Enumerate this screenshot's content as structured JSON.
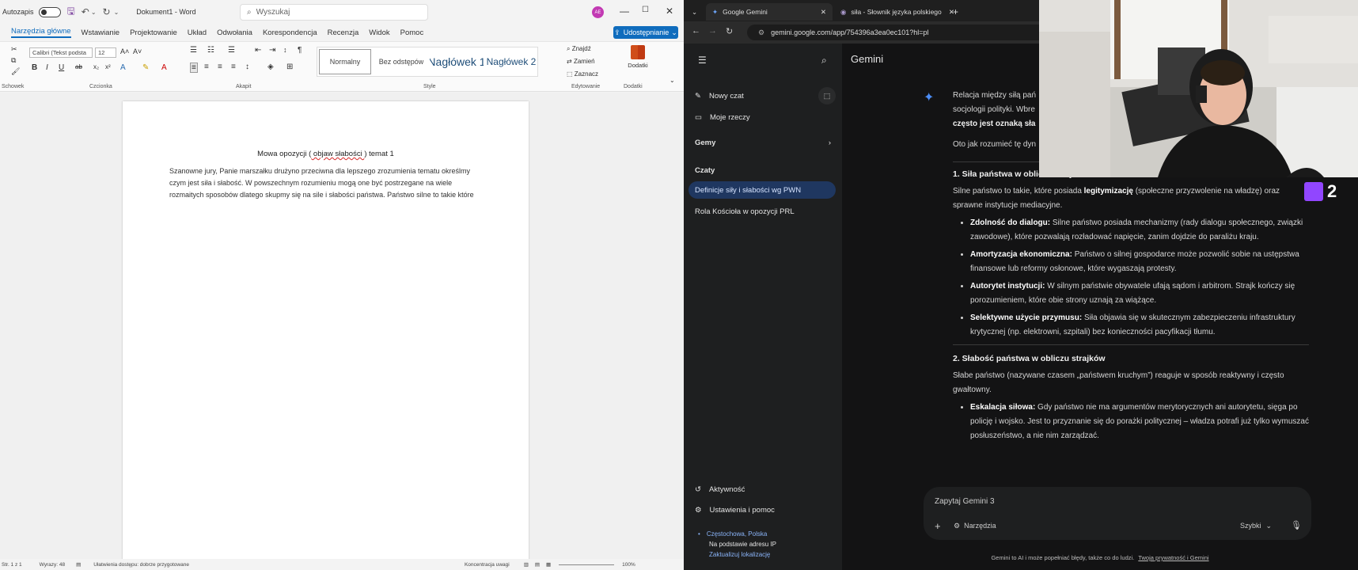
{
  "word": {
    "autosave_label": "Autozapis",
    "doc_title": "Dokument1 - Word",
    "search_placeholder": "Wyszukaj",
    "avatar": "AE",
    "menu": [
      "Narzędzia główne",
      "Wstawianie",
      "Projektowanie",
      "Układ",
      "Odwołania",
      "Korespondencja",
      "Recenzja",
      "Widok",
      "Pomoc"
    ],
    "share_label": "Udostępnianie",
    "font_name": "Calibri (Tekst podsta",
    "font_size": "12",
    "styles": [
      "Normalny",
      "Bez odstępów",
      "Nagłówek 1",
      "Nagłówek 2"
    ],
    "editing": {
      "find": "Znajdź",
      "replace": "Zamień",
      "select": "Zaznacz"
    },
    "addins_label": "Dodatki",
    "groups": {
      "clipboard": "Schowek",
      "font": "Czcionka",
      "paragraph": "Akapit",
      "styles": "Style",
      "editing": "Edytowanie",
      "addins": "Dodatki"
    },
    "document": {
      "title_prefix": "Mowa opozycji (",
      "title_underlined": " objaw słabości ",
      "title_suffix": ") temat 1",
      "body": "Szanowne jury, Panie marszałku drużyno przeciwna dla lepszego zrozumienia tematu określmy czym jest siła i słabość. W powszechnym rozumieniu mogą one być postrzegane na wiele rozmaitych sposobów dlatego skupmy się na sile i słabości państwa. Państwo silne to takie które"
    },
    "status": {
      "page": "Str. 1 z 1",
      "words": "Wyrazy: 48",
      "accessibility": "Ułatwienia dostępu: dobrze przygotowane",
      "focus": "Koncentracja uwagi",
      "zoom": "100%"
    }
  },
  "browser": {
    "tabs": [
      {
        "label": "Google Gemini"
      },
      {
        "label": "siła - Słownik języka polskiego"
      }
    ],
    "url": "gemini.google.com/app/754396a3ea0ec101?hl=pl"
  },
  "gemini": {
    "app_title": "Gemini",
    "new_chat": "Nowy czat",
    "my_stuff": "Moje rzeczy",
    "gems": "Gemy",
    "chats_header": "Czaty",
    "chats": [
      "Definicje siły i słabości wg PWN",
      "Rola Kościoła w opozycji PRL"
    ],
    "activity": "Aktywność",
    "settings": "Ustawienia i pomoc",
    "location": "Częstochowa, Polska",
    "location_source": "Na podstawie adresu IP",
    "update_location": "Zaktualizuj lokalizację",
    "intro_line1": "Relacja między siłą pań",
    "intro_line2": "socjologii polityki. Wbre",
    "intro_line3": "często jest oznaką sła",
    "intro_line4": "Oto jak rozumieć tę dyn",
    "section1_title": "1. Siła państwa w obliczu strajków",
    "section1_intro_a": "Silne państwo to takie, które posiada ",
    "section1_intro_b": "legitymizację",
    "section1_intro_c": " (społeczne przyzwolenie na władzę) oraz sprawne instytucje mediacyjne.",
    "section1_items": [
      {
        "head": "Zdolność do dialogu:",
        "text": " Silne państwo posiada mechanizmy (rady dialogu społecznego, związki zawodowe), które pozwalają rozładować napięcie, zanim dojdzie do paraliżu kraju."
      },
      {
        "head": "Amortyzacja ekonomiczna:",
        "text": " Państwo o silnej gospodarce może pozwolić sobie na ustępstwa finansowe lub reformy osłonowe, które wygaszają protesty."
      },
      {
        "head": "Autorytet instytucji:",
        "text": " W silnym państwie obywatele ufają sądom i arbitrom. Strajk kończy się porozumieniem, które obie strony uznają za wiążące."
      },
      {
        "head": "Selektywne użycie przymusu:",
        "text": " Siła objawia się w skutecznym zabezpieczeniu infrastruktury krytycznej (np. elektrowni, szpitali) bez konieczności pacyfikacji tłumu."
      }
    ],
    "section2_title": "2. Słabość państwa w obliczu strajków",
    "section2_intro": "Słabe państwo (nazywane czasem „państwem kruchym”) reaguje w sposób reaktywny i często gwałtowny.",
    "section2_items": [
      {
        "head": "Eskalacja siłowa:",
        "text": " Gdy państwo nie ma argumentów merytorycznych ani autorytetu, sięga po policję i wojsko. Jest to przyznanie się do porażki politycznej – władza potrafi już tylko wymuszać posłuszeństwo, a nie nim zarządzać."
      }
    ],
    "input_placeholder": "Zapytaj Gemini 3",
    "tools_label": "Narzędzia",
    "mode_label": "Szybki",
    "disclaimer": "Gemini to AI i może popełniać błędy, także co do ludzi.",
    "privacy_link": "Twoja prywatność i Gemini"
  },
  "overlay": {
    "twitch_count": "2"
  },
  "colors": {
    "word_blue": "#0f6cbd",
    "gemini_bg": "#131314",
    "sidebar_bg": "#1e1f20",
    "active_chat": "#1f3760",
    "link": "#8ab4f8"
  }
}
